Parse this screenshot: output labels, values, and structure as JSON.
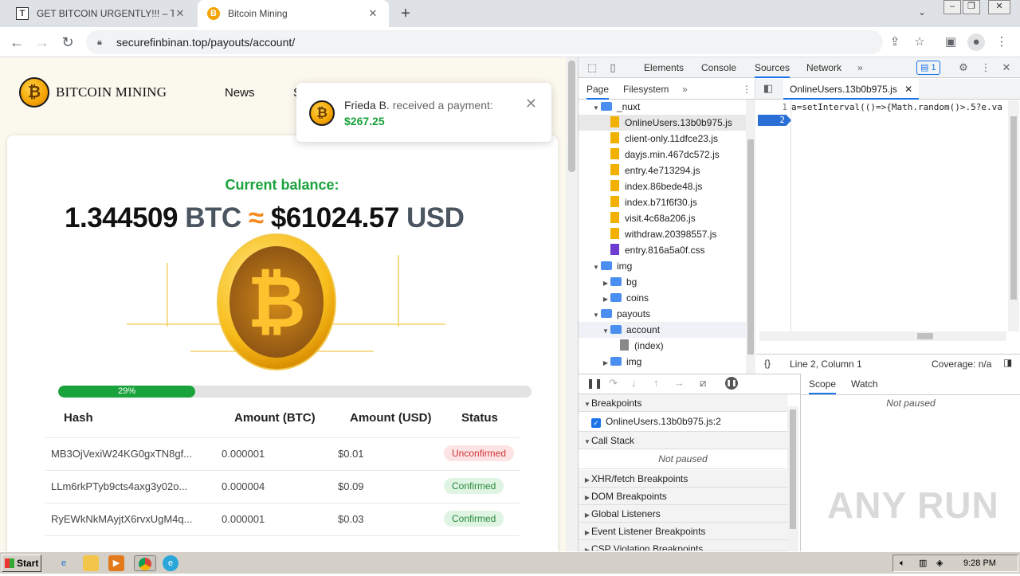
{
  "browser": {
    "tabs": [
      {
        "favicon": "T",
        "title": "GET BITCOIN URGENTLY!!! – Telegra",
        "active": false
      },
      {
        "favicon": "B",
        "title": "Bitcoin Mining",
        "active": true
      }
    ],
    "url": "securefinbinan.top/payouts/account/"
  },
  "site": {
    "logo_text": "BITCOIN MINING",
    "nav": [
      "News",
      "S"
    ],
    "balance_title": "Current balance:",
    "balance_btc": "1.344509",
    "unit_btc": "BTC",
    "approx": "≈",
    "balance_usd": "$61024.57",
    "unit_usd": "USD",
    "progress_label": "29%",
    "progress_value": 0.29,
    "table": {
      "headers": [
        "Hash",
        "Amount (BTC)",
        "Amount (USD)",
        "Status"
      ],
      "rows": [
        {
          "hash": "MB3OjVexiW24KG0gxTN8gf...",
          "btc": "0.000001",
          "usd": "$0.01",
          "status": "Unconfirmed"
        },
        {
          "hash": "LLm6rkPTyb9cts4axg3y02o...",
          "btc": "0.000004",
          "usd": "$0.09",
          "status": "Confirmed"
        },
        {
          "hash": "RyEWkNkMAyjtX6rvxUgM4q...",
          "btc": "0.000001",
          "usd": "$0.03",
          "status": "Confirmed"
        }
      ]
    },
    "toast": {
      "name": "Frieda B.",
      "text": " received a payment:",
      "amount": "$267.25"
    }
  },
  "devtools": {
    "tabs": [
      "Elements",
      "Console",
      "Sources",
      "Network"
    ],
    "issues_count": "1",
    "nav_tabs": [
      "Page",
      "Filesystem"
    ],
    "tree": [
      {
        "label": "_nuxt",
        "type": "folder",
        "indent": 1,
        "expanded": true
      },
      {
        "label": "OnlineUsers.13b0b975.js",
        "type": "js",
        "indent": 2,
        "selected": true
      },
      {
        "label": "client-only.11dfce23.js",
        "type": "js",
        "indent": 2
      },
      {
        "label": "dayjs.min.467dc572.js",
        "type": "js",
        "indent": 2
      },
      {
        "label": "entry.4e713294.js",
        "type": "js",
        "indent": 2
      },
      {
        "label": "index.86bede48.js",
        "type": "js",
        "indent": 2
      },
      {
        "label": "index.b71f6f30.js",
        "type": "js",
        "indent": 2
      },
      {
        "label": "visit.4c68a206.js",
        "type": "js",
        "indent": 2
      },
      {
        "label": "withdraw.20398557.js",
        "type": "js",
        "indent": 2
      },
      {
        "label": "entry.816a5a0f.css",
        "type": "css",
        "indent": 2
      },
      {
        "label": "img",
        "type": "folder",
        "indent": 1,
        "expanded": true
      },
      {
        "label": "bg",
        "type": "folder",
        "indent": 2,
        "expanded": false
      },
      {
        "label": "coins",
        "type": "folder",
        "indent": 2,
        "expanded": false
      },
      {
        "label": "payouts",
        "type": "folder",
        "indent": 1,
        "expanded": true
      },
      {
        "label": "account",
        "type": "folder",
        "indent": 2,
        "expanded": true,
        "highlight": true
      },
      {
        "label": "(index)",
        "type": "doc",
        "indent": 3
      },
      {
        "label": "img",
        "type": "folder",
        "indent": 2,
        "expanded": false
      }
    ],
    "editor_tab": "OnlineUsers.13b0b975.js",
    "code_line1": "a=setInterval(()=>{Math.random()>.5?e.va",
    "line_numbers": [
      "1",
      "2"
    ],
    "status_pos": "Line 2, Column 1",
    "coverage": "Coverage: n/a",
    "scope_tabs": [
      "Scope",
      "Watch"
    ],
    "not_paused": "Not paused",
    "sections": {
      "breakpoints": "Breakpoints",
      "breakpoint_item": "OnlineUsers.13b0b975.js:2",
      "call_stack": "Call Stack",
      "call_stack_body": "Not paused",
      "xhr": "XHR/fetch Breakpoints",
      "dom": "DOM Breakpoints",
      "global": "Global Listeners",
      "event": "Event Listener Breakpoints",
      "csp": "CSP Violation Breakpoints"
    }
  },
  "watermark": "ANY RUN",
  "taskbar": {
    "start": "Start",
    "time": "9:28 PM"
  }
}
